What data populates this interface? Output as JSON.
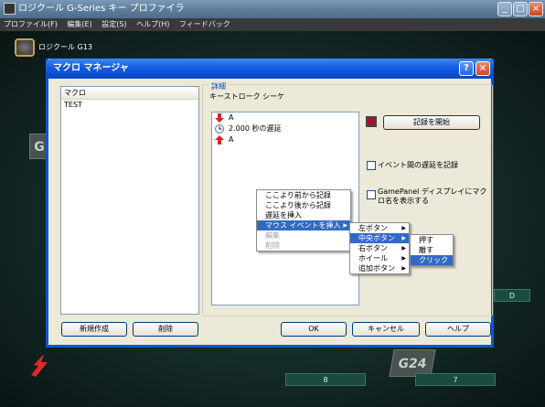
{
  "app": {
    "title": "ロジクール G-Series キー プロファイラ",
    "menu": [
      "プロファイル(F)",
      "編集(E)",
      "設定(S)",
      "ヘルプ(H)",
      "フィードバック"
    ],
    "window_buttons": {
      "minimize": "_",
      "maximize": "□",
      "close": "×"
    },
    "device_tab": "ロジクール G13",
    "background_keys": [
      "G",
      "G24",
      "D",
      "8",
      "7"
    ]
  },
  "dialog": {
    "title": "マクロ マネージャ",
    "help_btn": "?",
    "close_btn": "×",
    "macro_list": {
      "header": "マクロ",
      "items": [
        "TEST"
      ]
    },
    "detail": {
      "group_label": "詳細",
      "sequence_label": "キーストローク シーケ",
      "sequence_items": [
        {
          "icon": "arrow-down",
          "text": "A"
        },
        {
          "icon": "clock",
          "text": "2.000 秒の遅延"
        },
        {
          "icon": "arrow-up",
          "text": "A"
        }
      ],
      "record_button": "記録を開始",
      "option_delay": "イベント間の遅延を記録",
      "option_gamepanel": "GamePanel ディスプレイにマクロ名を表示する"
    },
    "buttons": {
      "new": "新規作成",
      "delete": "削除",
      "ok": "OK",
      "cancel": "キャンセル",
      "help": "ヘルプ"
    }
  },
  "context_menu": {
    "items": [
      {
        "label": "ここより前から記録",
        "enabled": true,
        "submenu": false,
        "selected": false
      },
      {
        "label": "ここより後から記録",
        "enabled": true,
        "submenu": false,
        "selected": false
      },
      {
        "label": "遅延を挿入",
        "enabled": true,
        "submenu": false,
        "selected": false
      },
      {
        "label": "マウス イベントを挿入",
        "enabled": true,
        "submenu": true,
        "selected": true
      },
      {
        "label": "編集",
        "enabled": false,
        "submenu": false,
        "selected": false
      },
      {
        "label": "削除",
        "enabled": false,
        "submenu": false,
        "selected": false
      }
    ],
    "mouse_submenu": [
      {
        "label": "左ボタン",
        "submenu": true,
        "selected": false
      },
      {
        "label": "中央ボタン",
        "submenu": true,
        "selected": true
      },
      {
        "label": "右ボタン",
        "submenu": true,
        "selected": false
      },
      {
        "label": "ホイール",
        "submenu": true,
        "selected": false
      },
      {
        "label": "追加ボタン",
        "submenu": true,
        "selected": false
      }
    ],
    "button_submenu": [
      {
        "label": "押す",
        "selected": false
      },
      {
        "label": "離す",
        "selected": false
      },
      {
        "label": "クリック",
        "selected": true
      }
    ]
  },
  "colors": {
    "title_blue": "#0a56d8",
    "menu_highlight": "#316ac5",
    "record_red": "#a4142a",
    "logo_red": "#e3262b"
  }
}
